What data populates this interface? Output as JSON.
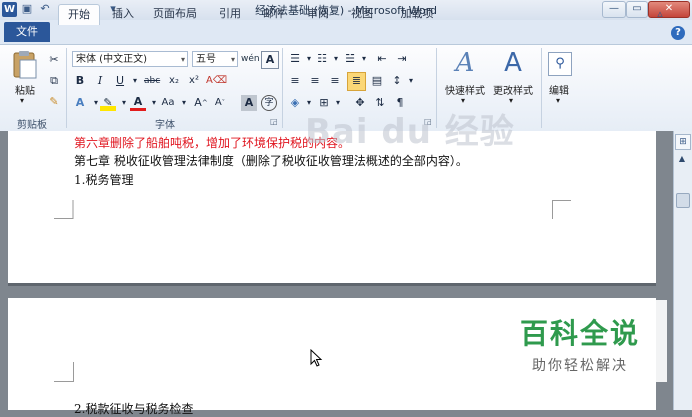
{
  "window": {
    "title": "经济法基础 (恢复) - Microsoft Word",
    "app_icon": "W"
  },
  "tabs": [
    "文件",
    "开始",
    "插入",
    "页面布局",
    "引用",
    "邮件",
    "审阅",
    "视图",
    "加载项"
  ],
  "ribbon": {
    "clipboard": {
      "label": "剪贴板",
      "paste": "粘贴"
    },
    "font": {
      "label": "字体",
      "font_name": "宋体 (中文正文)",
      "font_size": "五号"
    },
    "styles": {
      "quick": "快速样式",
      "change": "更改样式"
    },
    "editing": {
      "label": "编辑"
    }
  },
  "document": {
    "lines": [
      {
        "text": "第六章删除了船舶吨税，增加了环境保护税的内容。",
        "color": "#e0141e"
      },
      {
        "text": "第七章 税收征收管理法律制度（删除了税收征收管理法概述的全部内容）。",
        "color": "#111111"
      },
      {
        "text": "1.税务管理",
        "color": "#111111"
      },
      {
        "text": "2.税款征收与税务检查",
        "color": "#111111"
      }
    ]
  },
  "watermark": {
    "title": "百科全说",
    "subtitle": "助你轻松解决",
    "baidu": "Bai du 经验"
  },
  "colors": {
    "accent": "#2b579a",
    "red_text": "#e0141e",
    "watermark_green": "#2f9a4d"
  }
}
